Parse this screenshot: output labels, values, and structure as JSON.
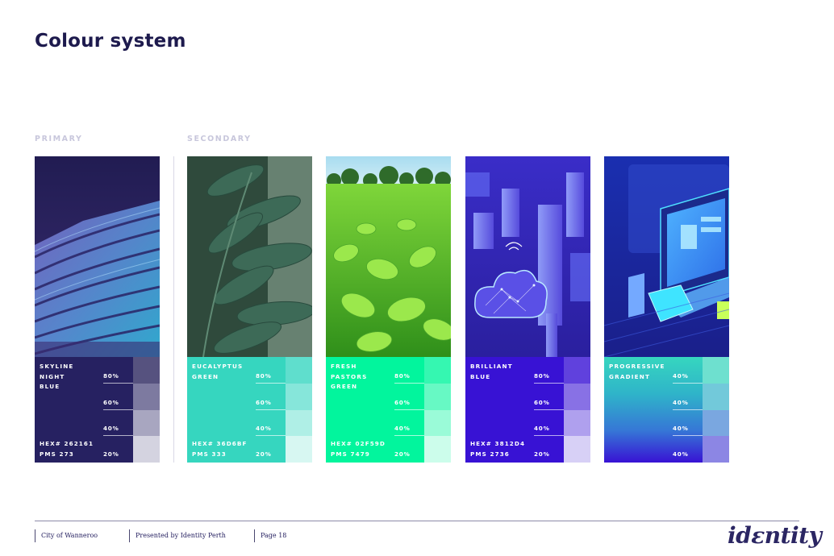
{
  "title": "Colour system",
  "sections": {
    "primary": "PRIMARY",
    "secondary": "SECONDARY"
  },
  "cards": [
    {
      "name_lines": [
        "SKYLINE",
        "NIGHT",
        "BLUE"
      ],
      "hex": "HEX# 262161",
      "pms": "PMS 273",
      "panel_color": "#262161",
      "tints": [
        {
          "label": "80%",
          "color": "#56527f"
        },
        {
          "label": "60%",
          "color": "#7d7aa0"
        },
        {
          "label": "40%",
          "color": "#a8a6c0"
        },
        {
          "label": "20%",
          "color": "#d4d3e0"
        }
      ]
    },
    {
      "name_lines": [
        "EUCALYPTUS",
        "GREEN"
      ],
      "hex": "HEX# 36D6BF",
      "pms": "PMS 333",
      "panel_color": "#36d6bf",
      "tints": [
        {
          "label": "80%",
          "color": "#5fdecd"
        },
        {
          "label": "60%",
          "color": "#86e6da"
        },
        {
          "label": "40%",
          "color": "#afefe6"
        },
        {
          "label": "20%",
          "color": "#d7f7f2"
        }
      ]
    },
    {
      "name_lines": [
        "FRESH",
        "PASTORS",
        "GREEN"
      ],
      "hex": "HEX# 02F59D",
      "pms": "PMS 7479",
      "panel_color": "#02f59d",
      "tints": [
        {
          "label": "80%",
          "color": "#35f7b1"
        },
        {
          "label": "60%",
          "color": "#67f9c4"
        },
        {
          "label": "40%",
          "color": "#9afbd8"
        },
        {
          "label": "20%",
          "color": "#ccfdeb"
        }
      ]
    },
    {
      "name_lines": [
        "BRILLIANT",
        "BLUE"
      ],
      "hex": "HEX# 3812D4",
      "pms": "PMS 2736",
      "panel_color": "#3812d4",
      "tints": [
        {
          "label": "80%",
          "color": "#6041dd"
        },
        {
          "label": "60%",
          "color": "#8871e5"
        },
        {
          "label": "40%",
          "color": "#afa0ee"
        },
        {
          "label": "20%",
          "color": "#d7d0f6"
        }
      ]
    },
    {
      "name_lines": [
        "PROGRESSIVE",
        "GRADIENT"
      ],
      "hex": "",
      "pms": "",
      "panel_color": "gradient",
      "tints": [
        {
          "label": "40%",
          "color": "#6ee0cf"
        },
        {
          "label": "40%",
          "color": "#72c9da"
        },
        {
          "label": "40%",
          "color": "#7aa7e0"
        },
        {
          "label": "40%",
          "color": "#8c86e4"
        }
      ]
    }
  ],
  "footer": {
    "client": "City of Wanneroo",
    "presented_by": "Presented by Identity Perth",
    "page": "Page 18",
    "logo": "idɛntity"
  }
}
